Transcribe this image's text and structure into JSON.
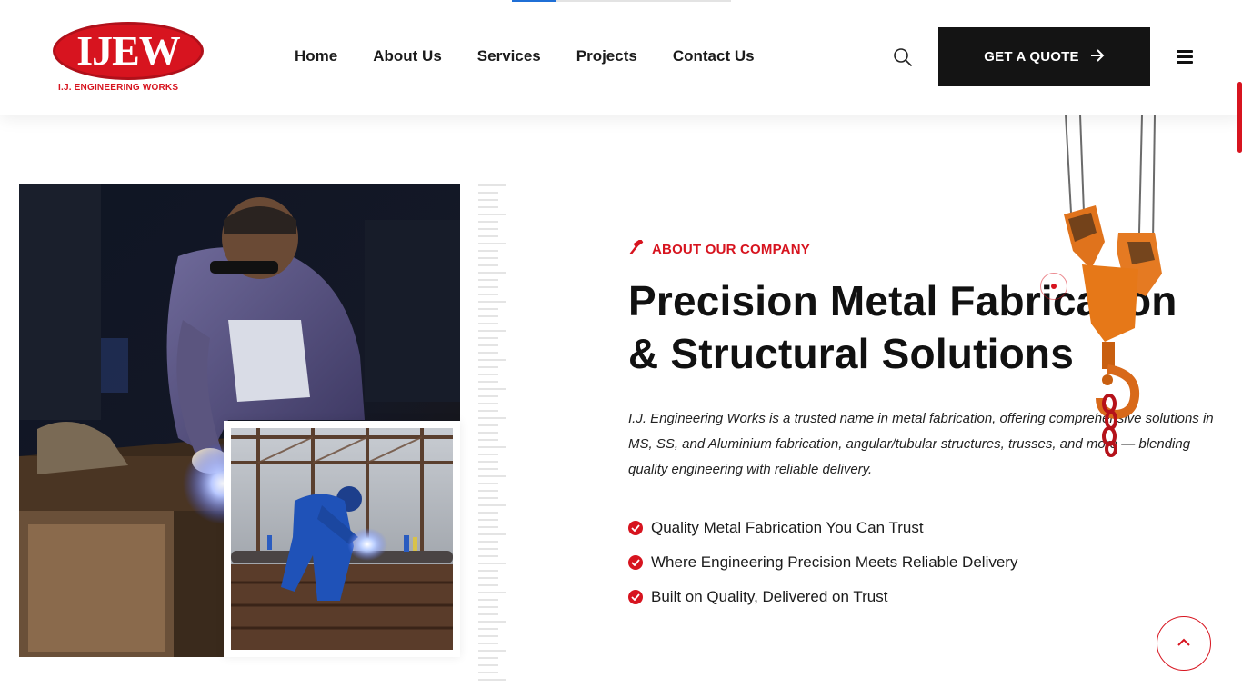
{
  "brand": {
    "logo_text": "IJEW",
    "logo_subtitle": "I.J. ENGINEERING WORKS",
    "accent_color": "#d7141f",
    "dark_color": "#141414"
  },
  "nav": {
    "items": [
      {
        "label": "Home"
      },
      {
        "label": "About Us"
      },
      {
        "label": "Services"
      },
      {
        "label": "Projects"
      },
      {
        "label": "Contact Us"
      }
    ]
  },
  "header": {
    "search_icon": "search-icon",
    "quote_label": "GET A QUOTE",
    "quote_icon": "arrow-right-icon",
    "menu_icon": "hamburger-menu-icon"
  },
  "about": {
    "eyebrow": "ABOUT OUR COMPANY",
    "eyebrow_icon": "hammer-icon",
    "heading_line1": "Precision Metal Fabrication",
    "heading_line2": "& Structural Solutions",
    "description": "I.J. Engineering Works is a trusted name in metal fabrication, offering comprehensive solutions in MS, SS, and Aluminium fabrication, angular/tubular structures, trusses, and more — blending quality engineering with reliable delivery.",
    "features": [
      {
        "label": "Quality Metal Fabrication You Can Trust",
        "icon": "check-circle-icon"
      },
      {
        "label": "Where Engineering Precision Meets Reliable Delivery",
        "icon": "check-circle-icon"
      },
      {
        "label": "Built on Quality, Delivered on Trust",
        "icon": "check-circle-icon"
      }
    ]
  },
  "back_to_top_icon": "chevron-up-icon"
}
